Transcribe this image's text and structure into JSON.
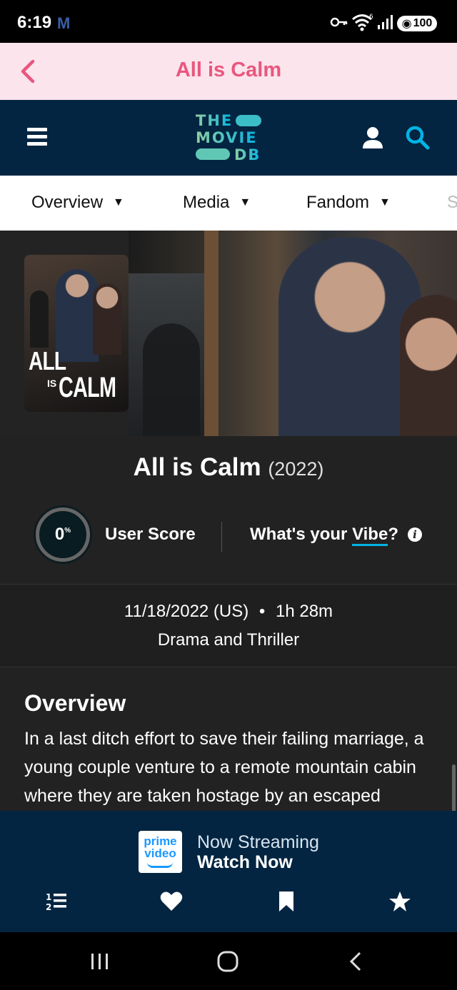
{
  "status_bar": {
    "time": "6:19",
    "notification_icon": "M",
    "battery": "100"
  },
  "title_bar": {
    "title": "All is Calm"
  },
  "header": {
    "logo_lines": [
      "THE",
      "MOVIE",
      "DB"
    ]
  },
  "tabs": [
    {
      "label": "Overview"
    },
    {
      "label": "Media"
    },
    {
      "label": "Fandom"
    },
    {
      "label": "S"
    }
  ],
  "poster": {
    "title_line1": "ALL",
    "title_is": "IS",
    "title_line2": "CALM"
  },
  "movie": {
    "title": "All is Calm",
    "year": "(2022)",
    "score": "0",
    "score_unit": "%",
    "score_label": "User Score",
    "vibe_prefix": "What's your ",
    "vibe_word": "Vibe",
    "vibe_suffix": "?",
    "release": "11/18/2022 (US)",
    "bullet": "•",
    "runtime": "1h 28m",
    "genres": "Drama and Thriller"
  },
  "overview": {
    "heading": "Overview",
    "text": "In a last ditch effort to save their failing marriage, a young couple venture to a remote mountain cabin where they are taken hostage by an escaped"
  },
  "streaming": {
    "provider_line1": "prime",
    "provider_line2": "video",
    "line1": "Now Streaming",
    "line2": "Watch Now"
  },
  "colors": {
    "tmdb_navy": "#032541",
    "tmdb_teal": "#90cea1",
    "tmdb_blue": "#01b4e4",
    "title_pink": "#e8577e",
    "title_bar_bg": "#fce4ec"
  }
}
